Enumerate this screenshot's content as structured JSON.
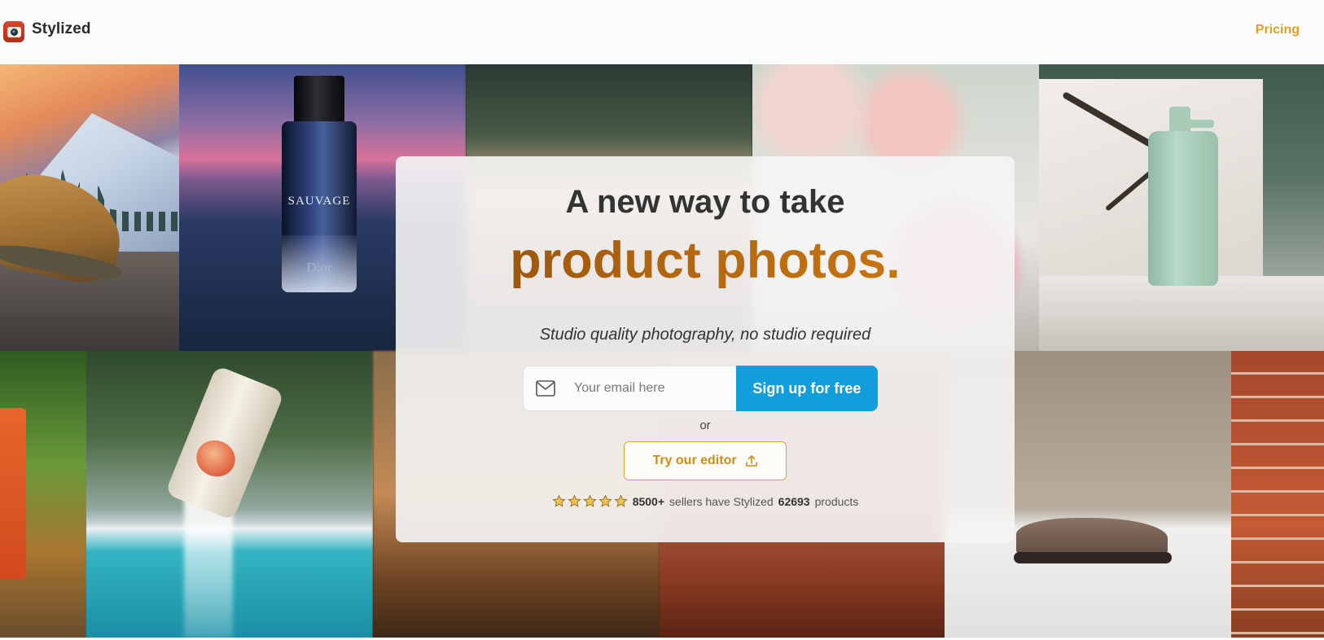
{
  "header": {
    "brand": "Stylized",
    "logo_icon": "camera-icon",
    "nav_pricing": "Pricing"
  },
  "mosaic": {
    "perfume_label": "SAUVAGE",
    "perfume_brand": "Dior"
  },
  "hero": {
    "line1": "A new way to take",
    "line2": "product photos.",
    "subtitle": "Studio quality photography, no studio required",
    "email_placeholder": "Your email here",
    "signup_label": "Sign up for free",
    "or_label": "or",
    "editor_label": "Try our editor",
    "social_proof": {
      "stars": 5,
      "sellers_count": "8500+",
      "text_middle": "sellers have Stylized",
      "products_count": "62693",
      "text_end": "products"
    }
  },
  "colors": {
    "accent_orange": "#e1a019",
    "signup_blue": "#129edb",
    "headline_gradient_start": "#8f4e0c",
    "headline_gradient_end": "#d17c14",
    "star": "#f2c14e"
  }
}
